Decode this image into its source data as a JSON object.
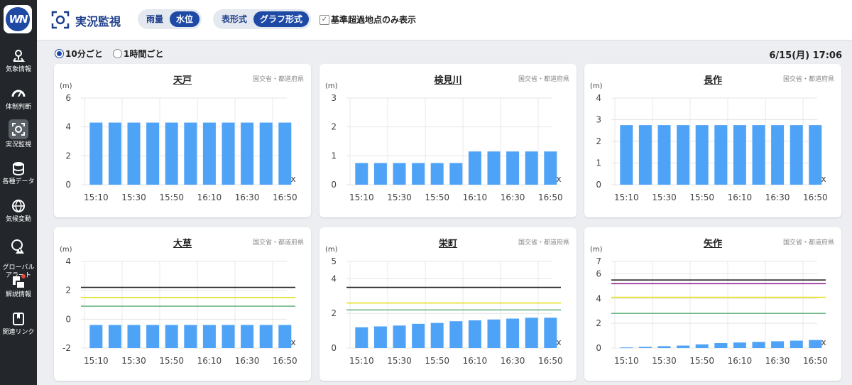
{
  "app": {
    "logo_text": "WN",
    "title": "実況監視",
    "rain_label": "雨量",
    "water_label": "水位",
    "table_label": "表形式",
    "graph_label": "グラフ形式",
    "filter_label": "基準超過地点のみ表示",
    "interval_10": "10分ごと",
    "interval_60": "1時間ごと",
    "datetime": "6/15(月) 17:06"
  },
  "sidebar": {
    "items": [
      {
        "label": "気象情報",
        "icon": "map-pin-icon"
      },
      {
        "label": "体制判断",
        "icon": "gauge-icon"
      },
      {
        "label": "実況監視",
        "icon": "monitor-eye-icon"
      },
      {
        "label": "各種データ",
        "icon": "database-icon"
      },
      {
        "label": "気候変動",
        "icon": "globe-icon"
      },
      {
        "label": "グローバル\nアラート",
        "icon": "global-alert-icon"
      },
      {
        "label": "解説情報",
        "icon": "commentary-icon"
      },
      {
        "label": "関連リンク",
        "icon": "book-link-icon"
      }
    ]
  },
  "colors": {
    "bar": "#4fa3f7",
    "accent": "#1e4aa6",
    "black_line": "#222222",
    "purple_line": "#8a1b8a",
    "yellow_line": "#e6e02a",
    "green_line": "#6fb88a"
  },
  "chart_data": [
    {
      "type": "bar",
      "title": "天戸",
      "source": "国交省・都道府県",
      "ylabel": "(m)",
      "ylim": [
        0,
        6
      ],
      "yticks": [
        0,
        2,
        4,
        6
      ],
      "categories": [
        "15:10",
        "15:20",
        "15:30",
        "15:40",
        "15:50",
        "16:00",
        "16:10",
        "16:20",
        "16:30",
        "16:40",
        "16:50"
      ],
      "xticks": [
        "15:10",
        "15:30",
        "15:50",
        "16:10",
        "16:30",
        "16:50"
      ],
      "values": [
        4.3,
        4.3,
        4.3,
        4.3,
        4.3,
        4.3,
        4.3,
        4.3,
        4.3,
        4.3,
        4.3
      ],
      "missing_marker": "x",
      "thresholds": []
    },
    {
      "type": "bar",
      "title": "検見川",
      "source": "国交省・都道府県",
      "ylabel": "(m)",
      "ylim": [
        0,
        3
      ],
      "yticks": [
        0,
        1,
        2,
        3
      ],
      "categories": [
        "15:10",
        "15:20",
        "15:30",
        "15:40",
        "15:50",
        "16:00",
        "16:10",
        "16:20",
        "16:30",
        "16:40",
        "16:50"
      ],
      "xticks": [
        "15:10",
        "15:30",
        "15:50",
        "16:10",
        "16:30",
        "16:50"
      ],
      "values": [
        0.75,
        0.75,
        0.75,
        0.75,
        0.75,
        0.75,
        1.15,
        1.15,
        1.15,
        1.15,
        1.15
      ],
      "missing_marker": "x",
      "thresholds": []
    },
    {
      "type": "bar",
      "title": "長作",
      "source": "国交省・都道府県",
      "ylabel": "(m)",
      "ylim": [
        0,
        4
      ],
      "yticks": [
        0,
        1,
        2,
        3,
        4
      ],
      "categories": [
        "15:10",
        "15:20",
        "15:30",
        "15:40",
        "15:50",
        "16:00",
        "16:10",
        "16:20",
        "16:30",
        "16:40",
        "16:50"
      ],
      "xticks": [
        "15:10",
        "15:30",
        "15:50",
        "16:10",
        "16:30",
        "16:50"
      ],
      "values": [
        2.75,
        2.75,
        2.75,
        2.75,
        2.75,
        2.75,
        2.75,
        2.75,
        2.75,
        2.75,
        2.75
      ],
      "missing_marker": "x",
      "thresholds": []
    },
    {
      "type": "bar",
      "title": "大草",
      "source": "国交省・都道府県",
      "ylabel": "(m)",
      "ylim": [
        -2,
        4
      ],
      "yticks": [
        -2,
        0,
        2,
        4
      ],
      "categories": [
        "15:10",
        "15:20",
        "15:30",
        "15:40",
        "15:50",
        "16:00",
        "16:10",
        "16:20",
        "16:30",
        "16:40",
        "16:50"
      ],
      "xticks": [
        "15:10",
        "15:30",
        "15:50",
        "16:10",
        "16:30",
        "16:50"
      ],
      "values": [
        -0.4,
        -0.4,
        -0.4,
        -0.4,
        -0.4,
        -0.4,
        -0.4,
        -0.4,
        -0.4,
        -0.4,
        -0.4
      ],
      "base": -2,
      "missing_marker": "x",
      "thresholds": [
        {
          "value": 2.2,
          "color": "#222222"
        },
        {
          "value": 1.5,
          "color": "#e6e02a"
        },
        {
          "value": 0.9,
          "color": "#6fb88a"
        }
      ]
    },
    {
      "type": "bar",
      "title": "栄町",
      "source": "国交省・都道府県",
      "ylabel": "(m)",
      "ylim": [
        0,
        5
      ],
      "yticks": [
        0,
        2,
        4,
        5
      ],
      "categories": [
        "15:10",
        "15:20",
        "15:30",
        "15:40",
        "15:50",
        "16:00",
        "16:10",
        "16:20",
        "16:30",
        "16:40",
        "16:50"
      ],
      "xticks": [
        "15:10",
        "15:30",
        "15:50",
        "16:10",
        "16:30",
        "16:50"
      ],
      "values": [
        1.2,
        1.25,
        1.3,
        1.4,
        1.45,
        1.55,
        1.6,
        1.65,
        1.7,
        1.75,
        1.75
      ],
      "missing_marker": "x",
      "thresholds": [
        {
          "value": 3.5,
          "color": "#222222"
        },
        {
          "value": 2.6,
          "color": "#e6e02a"
        },
        {
          "value": 2.2,
          "color": "#6fb88a"
        }
      ]
    },
    {
      "type": "bar",
      "title": "矢作",
      "source": "国交省・都道府県",
      "ylabel": "(m)",
      "ylim": [
        0,
        7
      ],
      "yticks": [
        0,
        2,
        4,
        6,
        7
      ],
      "categories": [
        "15:10",
        "15:20",
        "15:30",
        "15:40",
        "15:50",
        "16:00",
        "16:10",
        "16:20",
        "16:30",
        "16:40",
        "16:50"
      ],
      "xticks": [
        "15:10",
        "15:30",
        "15:50",
        "16:10",
        "16:30",
        "16:50"
      ],
      "values": [
        0.05,
        0.1,
        0.15,
        0.2,
        0.3,
        0.4,
        0.45,
        0.5,
        0.55,
        0.6,
        0.65
      ],
      "missing_marker": "x",
      "thresholds": [
        {
          "value": 5.5,
          "color": "#222222"
        },
        {
          "value": 5.2,
          "color": "#8a1b8a"
        },
        {
          "value": 4.1,
          "color": "#e6e02a"
        },
        {
          "value": 2.8,
          "color": "#6fb88a"
        }
      ]
    }
  ]
}
